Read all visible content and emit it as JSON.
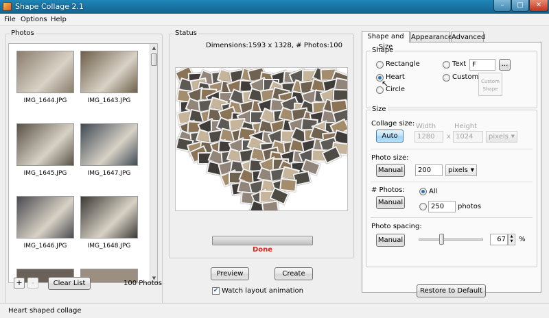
{
  "window": {
    "title": "Shape Collage 2.1",
    "controls": {
      "minimize": "–",
      "maximize": "□",
      "close": "✕"
    }
  },
  "menu": [
    "File",
    "Options",
    "Help"
  ],
  "photos_panel": {
    "label": "Photos",
    "thumbnails": [
      {
        "name": "IMG_1644.JPG",
        "color": "#8a7d6c"
      },
      {
        "name": "IMG_1643.JPG",
        "color": "#6e5f4a"
      },
      {
        "name": "IMG_1645.JPG",
        "color": "#5b5247"
      },
      {
        "name": "IMG_1647.JPG",
        "color": "#3f4a55"
      },
      {
        "name": "IMG_1646.JPG",
        "color": "#4a4a50"
      },
      {
        "name": "IMG_1648.JPG",
        "color": "#3d3a36"
      }
    ],
    "add_label": "+",
    "remove_label": "-",
    "clear_label": "Clear List",
    "count": "100 Photos"
  },
  "status_panel": {
    "label": "Status",
    "dimensions": "Dimensions:1593 x 1328, # Photos:100",
    "progress_fraction": 1.0,
    "done_text": "Done",
    "done_color": "#e0261a",
    "preview_label": "Preview",
    "create_label": "Create",
    "watch_label": "Watch layout animation",
    "watch_checked": true
  },
  "tabs": [
    "Shape and Size",
    "Appearance",
    "Advanced"
  ],
  "shape": {
    "label": "Shape",
    "rectangle": "Rectangle",
    "heart": "Heart",
    "circle": "Circle",
    "text": "Text",
    "text_value": "F",
    "browse": "...",
    "custom": "Custom",
    "custom_shape": "Custom\nShape",
    "selected": "heart"
  },
  "size": {
    "label": "Size",
    "collage_size_label": "Collage size:",
    "auto_label": "Auto",
    "width_label": "Width",
    "height_label": "Height",
    "width_value": "1280",
    "times": "x",
    "height_value": "1024",
    "units_dim": "pixels",
    "photo_size_label": "Photo size:",
    "photo_manual_label": "Manual",
    "photo_size_value": "200",
    "photo_units": "pixels",
    "photos_label": "# Photos:",
    "photos_manual_label": "Manual",
    "all_label": "All",
    "photos_value": "250",
    "photos_unit": "photos",
    "spacing_label": "Photo spacing:",
    "spacing_manual_label": "Manual",
    "spacing_value": "67",
    "spacing_unit": "%",
    "spacing_fraction": 0.33
  },
  "restore_label": "Restore to Default",
  "status_bar": "Heart shaped collage"
}
